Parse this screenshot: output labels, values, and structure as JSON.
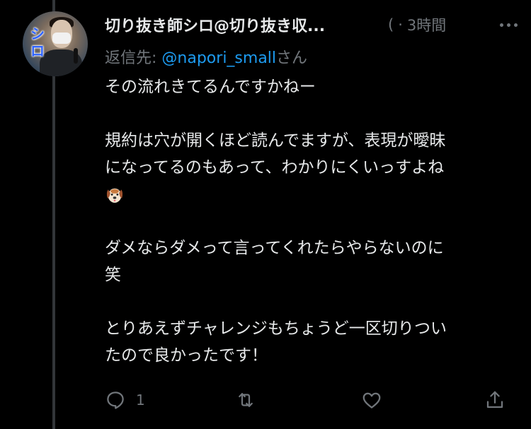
{
  "tweet": {
    "avatar_logo": "シロ",
    "display_name": "切り抜き師シロ@切り抜き収...",
    "meta_prefix": "(",
    "meta_separator": "·",
    "timestamp": "3時間",
    "reply_to_label": "返信先:",
    "reply_to_handle": "@napori_small",
    "reply_to_suffix": "さん",
    "lines": {
      "l1": "その流れきてるんですかねー",
      "l2": "規約は穴が開くほど読んでますが、表現が曖昧",
      "l3": "になってるのもあって、わかりにくいっすよね",
      "l4": "ダメならダメって言ってくれたらやらないのに",
      "l5": "笑",
      "l6": "とりあえずチャレンジもちょうど一区切りつい",
      "l7": "たので良かったです！"
    },
    "emoji": "dog-face",
    "actions": {
      "reply_icon": "reply-bubble-icon",
      "reply_count": "1",
      "retweet_icon": "retweet-icon",
      "like_icon": "heart-icon",
      "share_icon": "share-upload-icon"
    }
  },
  "colors": {
    "background": "#000000",
    "text_primary": "#e7e9ea",
    "text_secondary": "#71767b",
    "link": "#1d9bf0",
    "thread_line": "#333639"
  }
}
